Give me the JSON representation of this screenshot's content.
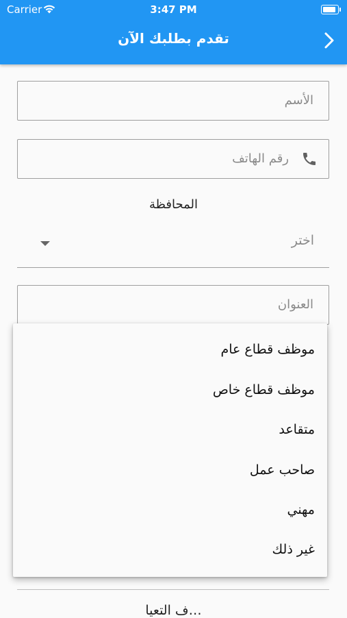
{
  "status_bar": {
    "carrier": "Carrier",
    "time": "3:47 PM"
  },
  "app_bar": {
    "title": "تقدم بطلبك الآن"
  },
  "form": {
    "name_placeholder": "الأسم",
    "phone_placeholder": "رقم الهاتف",
    "governorate_label": "المحافظة",
    "governorate_value": "اختر",
    "address_placeholder": "العنوان",
    "bottom_label": "…ف التعيا"
  },
  "menu": {
    "items": [
      "موظف قطاع عام",
      "موظف قطاع خاص",
      "متقاعد",
      "صاحب عمل",
      "مهني",
      "غير ذلك"
    ]
  },
  "colors": {
    "primary": "#2196f3",
    "background": "#fafafa",
    "border": "#9e9e9e",
    "hint": "#8a8a8a"
  }
}
